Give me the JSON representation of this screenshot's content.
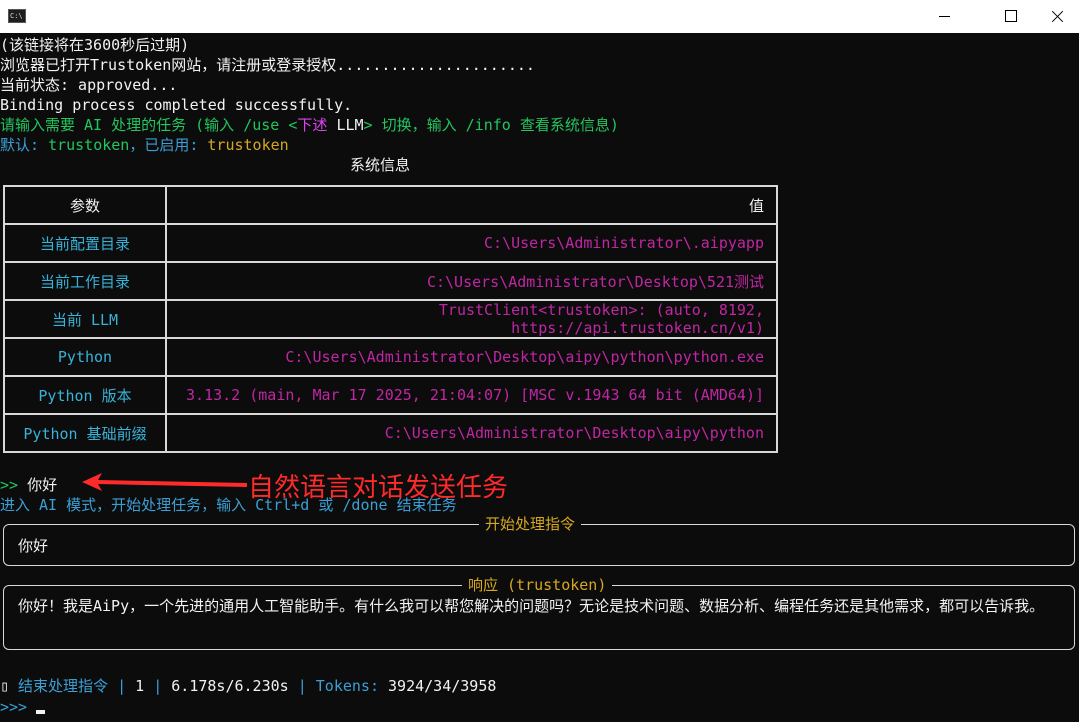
{
  "lines": {
    "l1": "(该链接将在3600秒后过期)",
    "l2": "浏览器已打开Trustoken网站，请注册或登录授权......................",
    "l3": "当前状态: approved...",
    "l4": "Binding process completed successfully.",
    "l5_a": "请输入需要 AI 处理的任务 (输入 /use <",
    "l5_b": "下述",
    "l5_c": " LLM",
    "l5_d": "> 切换，输入 /info 查看系统信息)",
    "l6_a": "默认: ",
    "l6_b": "trustoken",
    "l6_c": "，已启用: ",
    "l6_d": "trustoken"
  },
  "table": {
    "title": "系统信息",
    "header_key": "参数",
    "header_value": "值",
    "rows": [
      {
        "key": "当前配置目录",
        "value": "C:\\Users\\Administrator\\.aipyapp"
      },
      {
        "key": "当前工作目录",
        "value": "C:\\Users\\Administrator\\Desktop\\521测试"
      },
      {
        "key": "当前 LLM",
        "value": "TrustClient<trustoken>: (auto, 8192, https://api.trustoken.cn/v1)"
      },
      {
        "key": "Python",
        "value": "C:\\Users\\Administrator\\Desktop\\aipy\\python\\python.exe"
      },
      {
        "key": "Python 版本",
        "value": "3.13.2 (main, Mar 17 2025, 21:04:07) [MSC v.1943 64 bit (AMD64)]"
      },
      {
        "key": "Python 基础前缀",
        "value": "C:\\Users\\Administrator\\Desktop\\aipy\\python"
      }
    ]
  },
  "prompt": {
    "marker": ">>",
    "input": " 你好"
  },
  "annotation": "自然语言对话发送任务",
  "mode_line": "进入 AI 模式，开始处理任务，输入 Ctrl+d 或 /done 结束任务",
  "instruction_box": {
    "title": "开始处理指令",
    "text": "你好"
  },
  "response_box": {
    "title": "响应 (trustoken)",
    "text": "你好！我是AiPy，一个先进的通用人工智能助手。有什么我可以帮您解决的问题吗？无论是技术问题、数据分析、编程任务还是其他需求，都可以告诉我。"
  },
  "status": {
    "icon": "▯",
    "label": " 结束处理指令 | ",
    "count": "1",
    "sep1": " | ",
    "time": "6.178s/6.230s",
    "sep2": " | ",
    "tokens_label": "Tokens: ",
    "tokens": "3924/34/3958"
  },
  "final_prompt": ">>>"
}
